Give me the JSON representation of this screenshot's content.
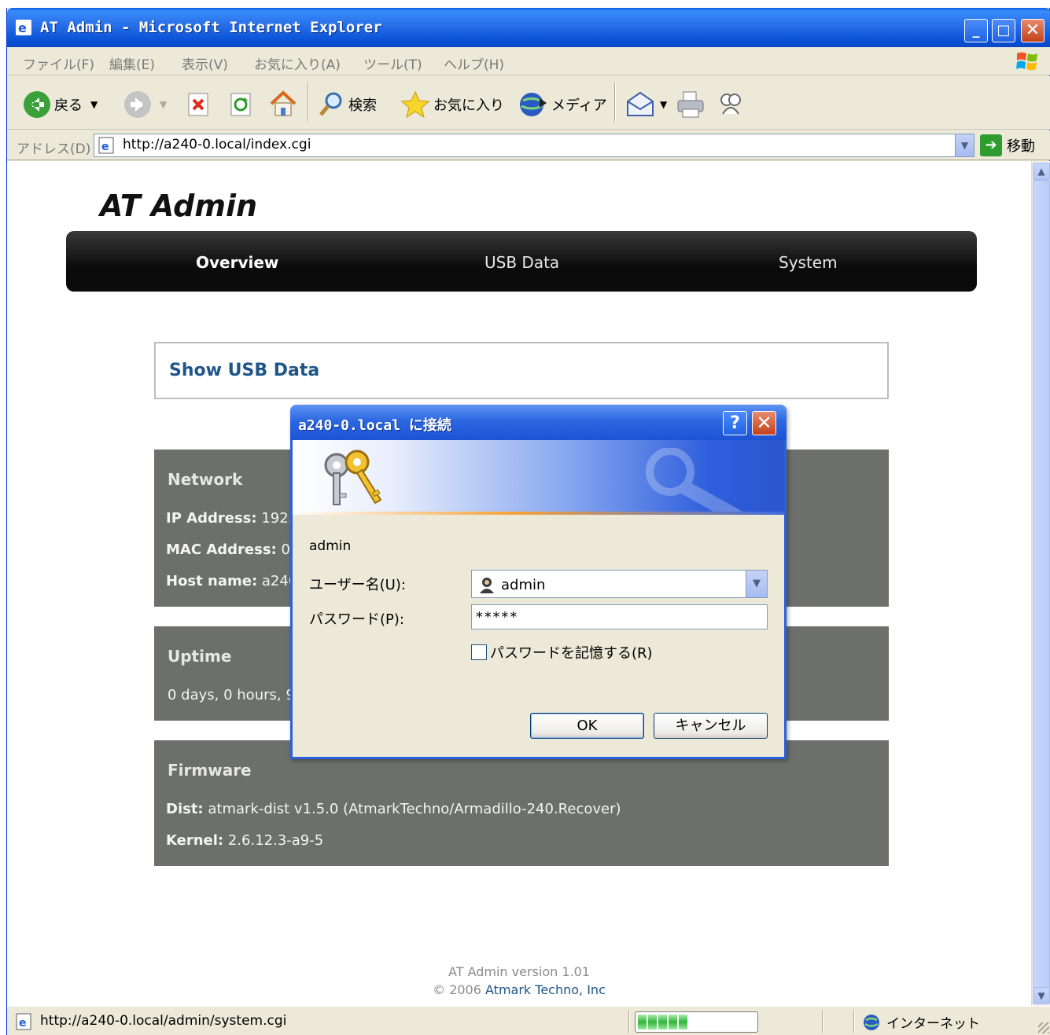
{
  "window": {
    "title": "AT Admin - Microsoft Internet Explorer",
    "controls": {
      "minimize": "_",
      "maximize": "□",
      "close": "✕"
    }
  },
  "menu": {
    "items": [
      "ファイル(F)",
      "編集(E)",
      "表示(V)",
      "お気に入り(A)",
      "ツール(T)",
      "ヘルプ(H)"
    ]
  },
  "toolbar": {
    "back_label": "戻る",
    "search_label": "検索",
    "favorites_label": "お気に入り",
    "media_label": "メディア"
  },
  "address": {
    "label": "アドレス(D)",
    "url": "http://a240-0.local/index.cgi",
    "go_label": "移動"
  },
  "page": {
    "site_title": "AT Admin",
    "nav": [
      "Overview",
      "USB Data",
      "System"
    ],
    "show_usb_link": "Show USB Data",
    "network": {
      "title": "Network",
      "ip_label": "IP Address:",
      "ip_value": "192.",
      "mac_label": "MAC Address:",
      "mac_value": "00",
      "host_label": "Host name:",
      "host_value": "a240"
    },
    "uptime": {
      "title": "Uptime",
      "value": "0 days, 0 hours, 9"
    },
    "firmware": {
      "title": "Firmware",
      "dist_label": "Dist:",
      "dist_value": "atmark-dist v1.5.0 (AtmarkTechno/Armadillo-240.Recover)",
      "kernel_label": "Kernel:",
      "kernel_value": "2.6.12.3-a9-5"
    },
    "footer": {
      "version": "AT Admin version 1.01",
      "copyright_prefix": "© 2006",
      "copyright_link": "Atmark Techno, Inc"
    }
  },
  "dialog": {
    "title": "a240-0.local に接続",
    "help": "?",
    "close": "✕",
    "realm": "admin",
    "username_label": "ユーザー名(U):",
    "username_value": "admin",
    "password_label": "パスワード(P):",
    "password_value": "*****",
    "remember_label": "パスワードを記憶する(R)",
    "remember_checked": false,
    "ok_label": "OK",
    "cancel_label": "キャンセル"
  },
  "status": {
    "text": "http://a240-0.local/admin/system.cgi",
    "progress_fraction": 0.45,
    "zone": "インターネット"
  }
}
